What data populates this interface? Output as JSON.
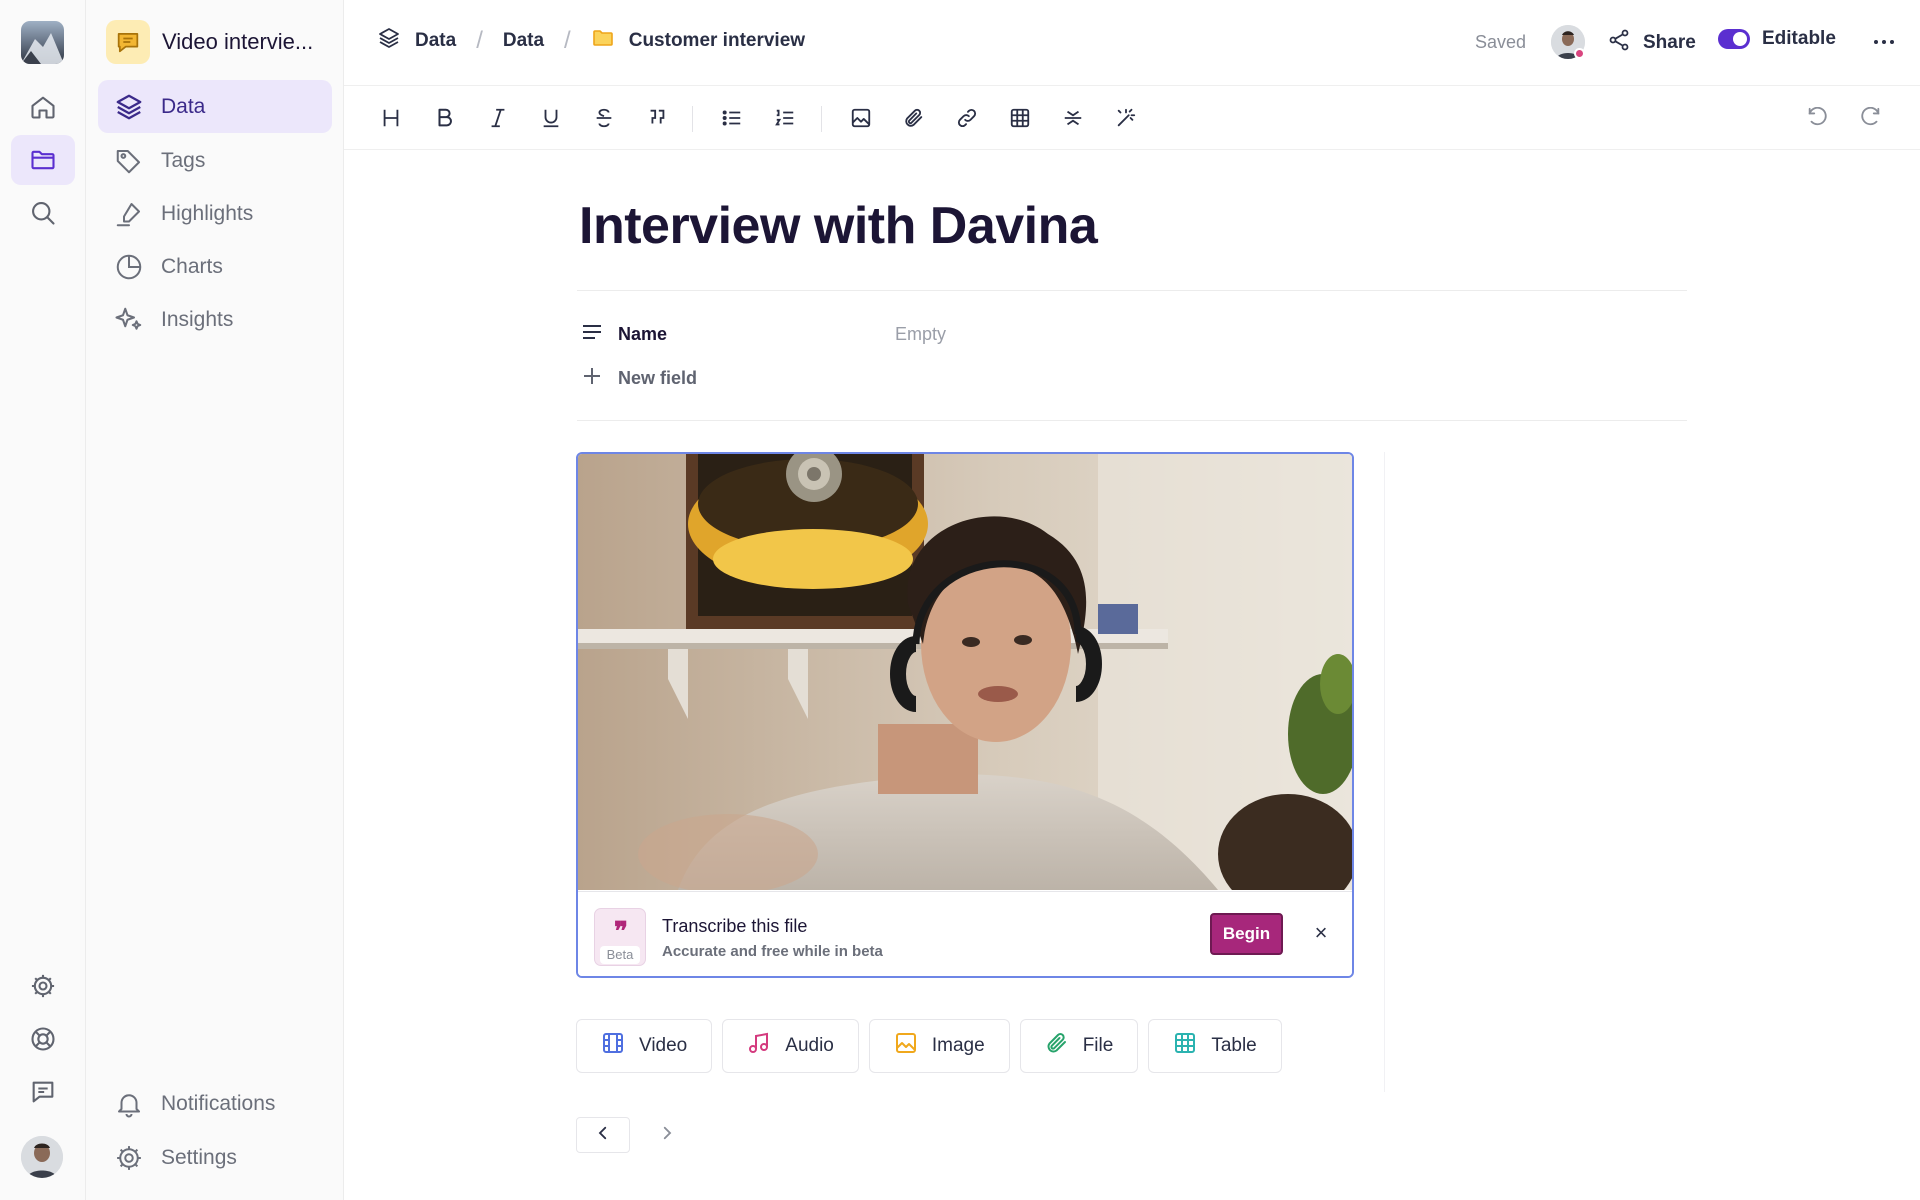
{
  "project": {
    "name": "Video intervie..."
  },
  "sidebar": {
    "items": [
      {
        "label": "Data",
        "icon": "layers-icon",
        "active": true
      },
      {
        "label": "Tags",
        "icon": "tags-icon"
      },
      {
        "label": "Highlights",
        "icon": "highlighter-icon"
      },
      {
        "label": "Charts",
        "icon": "pie-chart-icon"
      },
      {
        "label": "Insights",
        "icon": "sparkles-icon"
      }
    ],
    "bottom": [
      {
        "label": "Notifications",
        "icon": "bell-icon"
      },
      {
        "label": "Settings",
        "icon": "gear-icon"
      }
    ]
  },
  "breadcrumb": [
    "Data",
    "Data",
    "Customer interview"
  ],
  "header": {
    "saved": "Saved",
    "share": "Share",
    "editable": "Editable"
  },
  "document": {
    "title": "Interview with Davina",
    "properties": [
      {
        "name": "Name",
        "value": "Empty"
      }
    ],
    "new_field": "New field"
  },
  "transcribe": {
    "title": "Transcribe this file",
    "subtitle": "Accurate and free while in beta",
    "badge": "Beta",
    "button": "Begin",
    "close": "×"
  },
  "media_buttons": [
    {
      "label": "Video",
      "icon": "video-icon",
      "color": "#4f6fe0"
    },
    {
      "label": "Audio",
      "icon": "music-icon",
      "color": "#d43a7e"
    },
    {
      "label": "Image",
      "icon": "image-icon",
      "color": "#f0a81c"
    },
    {
      "label": "File",
      "icon": "link-icon",
      "color": "#27a36b"
    },
    {
      "label": "Table",
      "icon": "table-icon",
      "color": "#2bb3b0"
    }
  ],
  "colors": {
    "accent": "#5b2fd0",
    "begin": "#a7277b",
    "video_border": "#6e86e6"
  }
}
